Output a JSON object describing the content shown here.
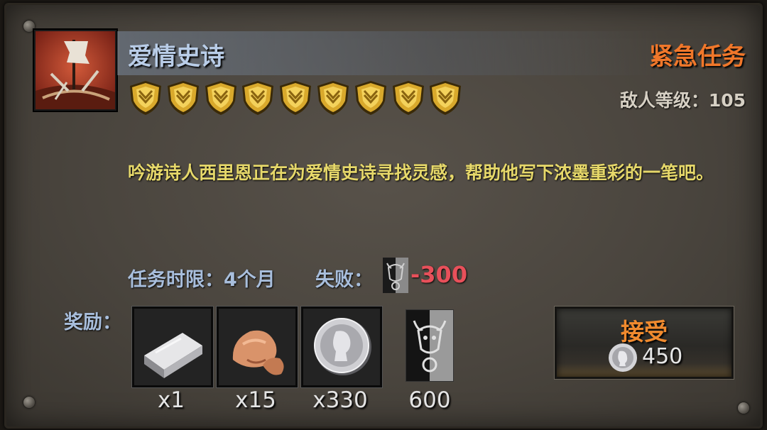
{
  "quest": {
    "title": "爱情史诗",
    "type_label": "紧急任务",
    "enemy_level_label": "敌人等级：105",
    "difficulty_stars": 9,
    "description": "吟游诗人西里恩正在为爱情史诗寻找灵感，帮助他写下浓墨重彩的一笔吧。",
    "time_limit_label": "任务时限：4个月",
    "fail_label": "失败：",
    "fail_value": "-300"
  },
  "rewards": {
    "label": "奖励：",
    "items": [
      {
        "name": "silver-ingot-icon",
        "count": "x1"
      },
      {
        "name": "copper-ore-icon",
        "count": "x15"
      },
      {
        "name": "silver-coin-icon",
        "count": "x330"
      },
      {
        "name": "cult-reputation-icon",
        "count": "600"
      }
    ]
  },
  "accept_button": {
    "label": "接受",
    "cost": "450",
    "cost_icon": "silver-coin-icon"
  },
  "colors": {
    "title": "#b9cde8",
    "urgent": "#f0772a",
    "description": "#e6d86a",
    "fail_value": "#e8505a",
    "accept_label": "#f08a2e"
  }
}
